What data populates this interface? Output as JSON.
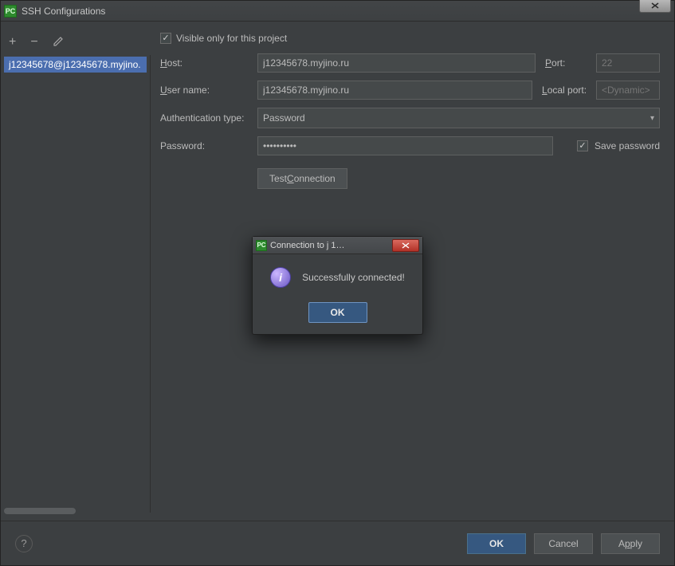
{
  "window": {
    "title": "SSH Configurations",
    "app_icon_text": "PC"
  },
  "sidebar": {
    "items": [
      {
        "label": "j12345678@j12345678.myjino."
      }
    ]
  },
  "form": {
    "visible_only_label": "Visible only for this project",
    "visible_only_checked": true,
    "host_label_pre": "H",
    "host_label_post": "ost:",
    "host_value": "j12345678.myjino.ru",
    "port_label_pre": "P",
    "port_label_post": "ort:",
    "port_value": "22",
    "user_label_pre": "U",
    "user_label_post": "ser name:",
    "user_value": "j12345678.myjino.ru",
    "localport_label_pre": "L",
    "localport_label_post": "ocal port:",
    "localport_placeholder": "<Dynamic>",
    "auth_label": "Authentication type:",
    "auth_value": "Password",
    "password_label": "Password:",
    "password_mask": "••••••••••",
    "save_password_label": "Save password",
    "save_password_checked": true,
    "test_connection_pre": "Test ",
    "test_connection_u": "C",
    "test_connection_post": "onnection"
  },
  "footer": {
    "ok": "OK",
    "cancel": "Cancel",
    "apply_pre": "A",
    "apply_u": "p",
    "apply_post": "ply"
  },
  "dialog": {
    "title": "Connection to j           1…",
    "message": "Successfully connected!",
    "ok": "OK",
    "app_icon_text": "PC"
  }
}
